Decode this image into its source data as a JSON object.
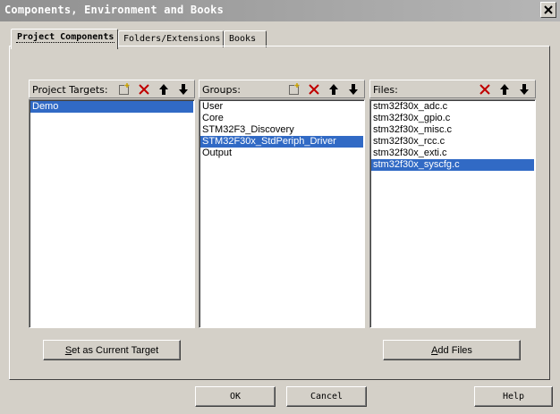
{
  "window": {
    "title": "Components, Environment and Books"
  },
  "tabs": [
    {
      "label": "Project Components",
      "active": true
    },
    {
      "label": "Folders/Extensions",
      "active": false
    },
    {
      "label": "Books",
      "active": false
    }
  ],
  "targets": {
    "title": "Project Targets:",
    "items": [
      "Demo"
    ],
    "selected_index": 0
  },
  "groups": {
    "title": "Groups:",
    "items": [
      "User",
      "Core",
      "STM32F3_Discovery",
      "STM32F30x_StdPeriph_Driver",
      "Output"
    ],
    "selected_index": 3
  },
  "files": {
    "title": "Files:",
    "items": [
      "stm32f30x_adc.c",
      "stm32f30x_gpio.c",
      "stm32f30x_misc.c",
      "stm32f30x_rcc.c",
      "stm32f30x_exti.c",
      "stm32f30x_syscfg.c"
    ],
    "selected_index": 5
  },
  "buttons": {
    "set_target": {
      "mnemonic": "S",
      "rest": "et as Current Target"
    },
    "add_files": {
      "mnemonic": "A",
      "rest": "dd Files"
    },
    "ok": "OK",
    "cancel": "Cancel",
    "help": "Help"
  },
  "icons": [
    "new-item-icon",
    "delete-icon",
    "move-up-icon",
    "move-down-icon",
    "close-icon"
  ],
  "colors": {
    "selection": "#316AC5",
    "delete_red": "#C00000",
    "face": "#D4D0C8"
  }
}
